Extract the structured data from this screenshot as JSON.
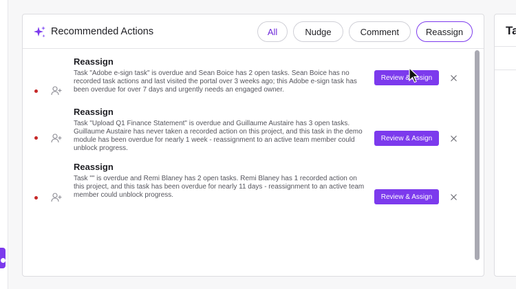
{
  "panel": {
    "title": "Recommended Actions",
    "filters": [
      "All",
      "Nudge",
      "Comment",
      "Reassign"
    ],
    "active_filter": "Reassign"
  },
  "actions": [
    {
      "title": "Reassign",
      "description": "Task \"Adobe e-sign task\" is overdue and Sean Boice has 2 open tasks. Sean Boice has no recorded task actions and last visited the portal over 3 weeks ago; this Adobe e-sign task has been overdue for over 7 days and urgently needs an engaged owner.",
      "button_label": "Review & Assign"
    },
    {
      "title": "Reassign",
      "description": "Task \"Upload Q1 Finance Statement\" is overdue and Guillaume Austaire has 3 open tasks. Guillaume Austaire has never taken a recorded action on this project, and this task in the demo module has been overdue for nearly 1 week - reassignment to an active team member could unblock progress.",
      "button_label": "Review & Assign"
    },
    {
      "title": "Reassign",
      "description": "Task \"\" is overdue and Remi Blaney has 2 open tasks. Remi Blaney has 1 recorded action on this project, and this task has been overdue for nearly 11 days - reassignment to an active team member could unblock progress.",
      "button_label": "Review & Assign"
    }
  ],
  "right_panel": {
    "title": "Ta"
  },
  "colors": {
    "accent": "#7c3aed",
    "status_dot": "#c62828",
    "scroll_thumb": "#a9a9b2"
  },
  "icons": {
    "header": "sparkle-icon",
    "row_avatar": "user-add-icon",
    "dismiss": "close-icon",
    "pointer": "cursor-arrow-icon"
  },
  "scroll": {
    "thumb_fraction": 0.94
  }
}
